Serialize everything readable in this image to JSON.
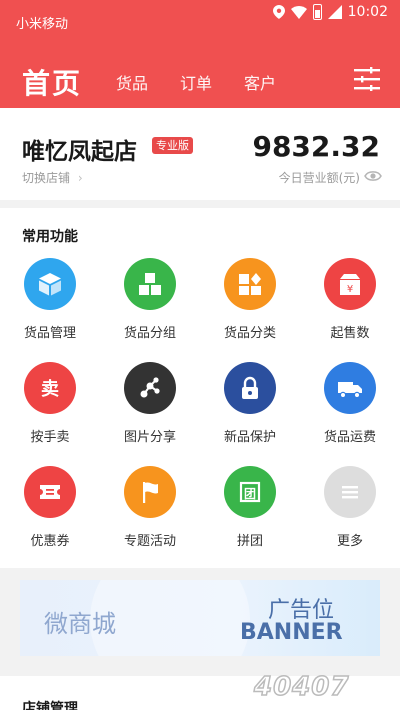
{
  "status": {
    "carrier": "小米移动",
    "time": "10:02"
  },
  "nav": {
    "home": "首页",
    "tabs": [
      "货品",
      "订单",
      "客户"
    ]
  },
  "store": {
    "name": "唯忆凤起店",
    "badge": "专业版",
    "switch_label": "切换店铺",
    "revenue": "9832.32",
    "revenue_label": "今日营业额(元)"
  },
  "features": {
    "title": "常用功能",
    "items": [
      {
        "label": "货品管理",
        "icon": "cube-icon",
        "color": "#2fa6ee"
      },
      {
        "label": "货品分组",
        "icon": "boxes-icon",
        "color": "#39b54a"
      },
      {
        "label": "货品分类",
        "icon": "category-icon",
        "color": "#f7941e"
      },
      {
        "label": "起售数",
        "icon": "package-yen-icon",
        "color": "#ee4444"
      },
      {
        "label": "按手卖",
        "icon": "sell-icon",
        "color": "#ee4444"
      },
      {
        "label": "图片分享",
        "icon": "share-icon",
        "color": "#333333"
      },
      {
        "label": "新品保护",
        "icon": "lock-icon",
        "color": "#2b4f9e"
      },
      {
        "label": "货品运费",
        "icon": "truck-icon",
        "color": "#2f7de1"
      },
      {
        "label": "优惠券",
        "icon": "coupon-icon",
        "color": "#ee4444"
      },
      {
        "label": "专题活动",
        "icon": "flag-icon",
        "color": "#f7941e"
      },
      {
        "label": "拼团",
        "icon": "group-icon",
        "color": "#39b54a"
      },
      {
        "label": "更多",
        "icon": "more-icon",
        "color": "#dddddd"
      }
    ]
  },
  "banner": {
    "left": "微商城",
    "ad": "广告位",
    "word": "BANNER"
  },
  "management": {
    "title": "店铺管理"
  },
  "watermark": "40407"
}
